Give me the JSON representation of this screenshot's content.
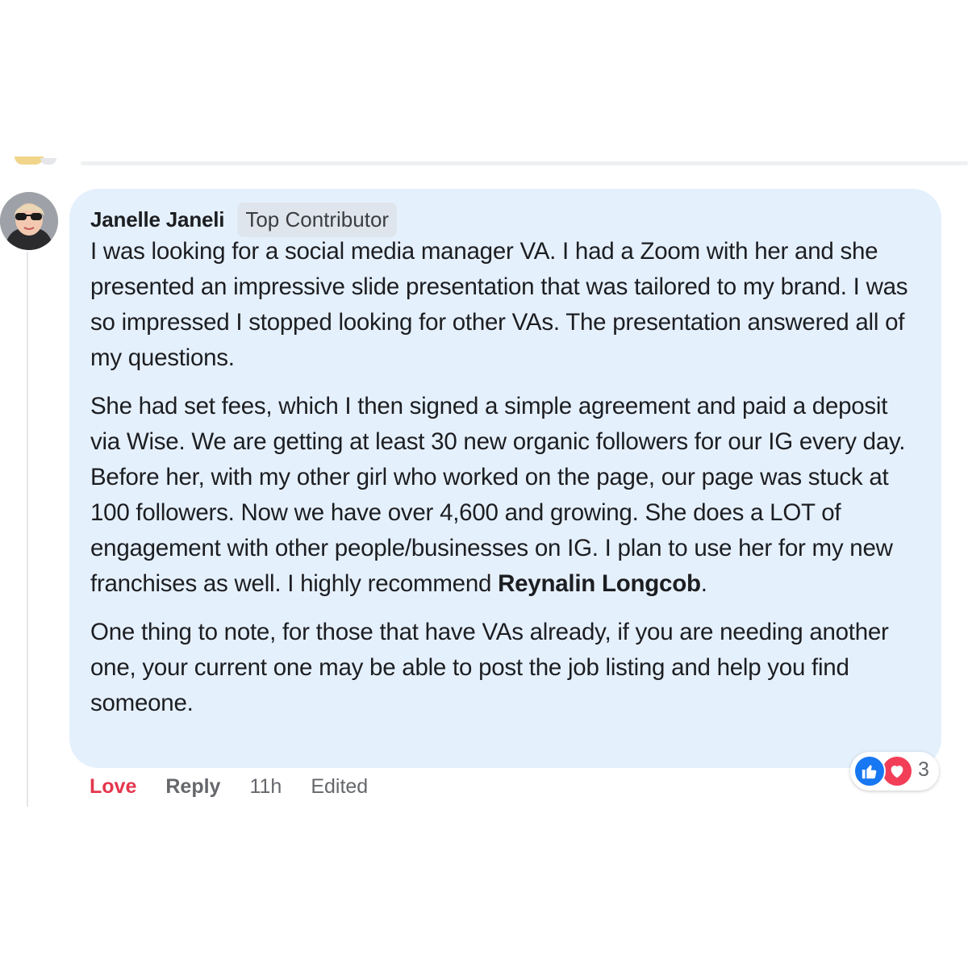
{
  "comment": {
    "author": "Janelle Janeli",
    "badge": "Top Contributor",
    "paragraph1": "I was looking for a social media manager VA. I had a Zoom with her and she presented an impressive slide presentation that was tailored to my brand. I was so impressed I stopped looking for other VAs. The presentation answered all of my questions.",
    "paragraph2_before_mention": "She had set fees, which I then signed a simple agreement and paid a deposit via Wise. We are getting at least 30 new organic followers for our IG every day. Before her, with my other girl who worked on the page, our page was stuck at 100 followers. Now we have over 4,600 and growing. She does a LOT of engagement with other people/businesses on IG. I plan to use her for my new franchises as well. I highly recommend ",
    "mention": "Reynalin Longcob",
    "paragraph2_after_mention": ".",
    "paragraph3": "One thing to note, for those that have VAs already, if you are needing another one, your current one may be able to post the job listing and help you find someone."
  },
  "actions": {
    "love_label": "Love",
    "reply_label": "Reply",
    "time": "11h",
    "edited_label": "Edited"
  },
  "reactions": {
    "icons": [
      "like-icon",
      "love-icon"
    ],
    "count": "3"
  },
  "colors": {
    "bubble": "#e5f0fd",
    "love_active": "#e4364d",
    "like_blue": "#1877f2",
    "love_red": "#f33e58",
    "muted_text": "#65676b"
  }
}
